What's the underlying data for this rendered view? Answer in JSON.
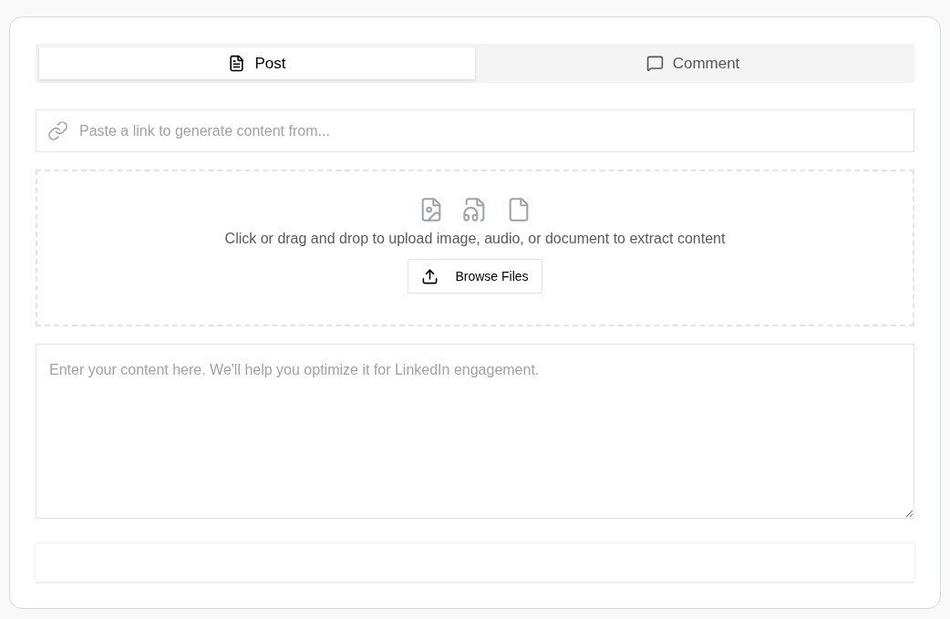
{
  "tabs": [
    {
      "label": "Post",
      "kind": "post",
      "selected": true
    },
    {
      "label": "Comment",
      "kind": "comment",
      "selected": false
    }
  ],
  "link_field": {
    "placeholder": "Paste a link to generate content from..."
  },
  "upload": {
    "hint": "Click or drag and drop to upload image, audio, or document to extract content",
    "button": "Browse Files"
  },
  "content_field": {
    "placeholder": "Enter your content here. We'll help you optimize it for LinkedIn engagement."
  }
}
